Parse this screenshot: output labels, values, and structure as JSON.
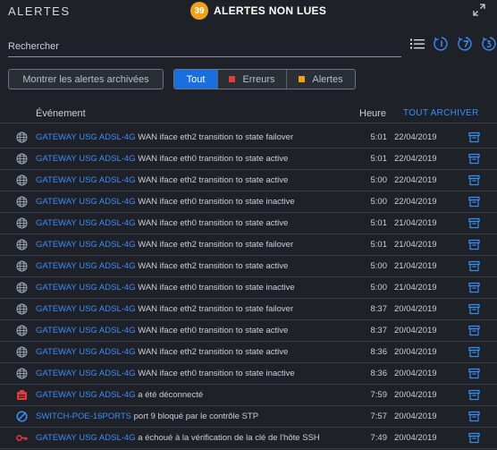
{
  "header": {
    "title": "ALERTES",
    "unread_count": "39",
    "unread_label": "ALERTES NON LUES"
  },
  "search": {
    "placeholder": "Rechercher"
  },
  "filters": {
    "show_archived": "Montrer les alertes archivées",
    "all": "Tout",
    "errors": "Erreurs",
    "alerts": "Alertes"
  },
  "columns": {
    "event": "Événement",
    "time": "Heure",
    "archive_all": "TOUT ARCHIVER"
  },
  "colors": {
    "accent": "#1a6fe0",
    "link": "#3b8cf5",
    "badge": "#f0a11c",
    "error": "#e23b3b",
    "warning": "#f0a11c"
  },
  "rows": [
    {
      "icon": "globe-icon",
      "device": "GATEWAY USG ADSL-4G",
      "message": "WAN iface eth2 transition to state failover",
      "time": "5:01",
      "date": "22/04/2019"
    },
    {
      "icon": "globe-icon",
      "device": "GATEWAY USG ADSL-4G",
      "message": "WAN iface eth0 transition to state active",
      "time": "5:01",
      "date": "22/04/2019"
    },
    {
      "icon": "globe-icon",
      "device": "GATEWAY USG ADSL-4G",
      "message": "WAN iface eth2 transition to state active",
      "time": "5:00",
      "date": "22/04/2019"
    },
    {
      "icon": "globe-icon",
      "device": "GATEWAY USG ADSL-4G",
      "message": "WAN iface eth0 transition to state inactive",
      "time": "5:00",
      "date": "22/04/2019"
    },
    {
      "icon": "globe-icon",
      "device": "GATEWAY USG ADSL-4G",
      "message": "WAN iface eth0 transition to state active",
      "time": "5:01",
      "date": "21/04/2019"
    },
    {
      "icon": "globe-icon",
      "device": "GATEWAY USG ADSL-4G",
      "message": "WAN iface eth2 transition to state failover",
      "time": "5:01",
      "date": "21/04/2019"
    },
    {
      "icon": "globe-icon",
      "device": "GATEWAY USG ADSL-4G",
      "message": "WAN iface eth2 transition to state active",
      "time": "5:00",
      "date": "21/04/2019"
    },
    {
      "icon": "globe-icon",
      "device": "GATEWAY USG ADSL-4G",
      "message": "WAN iface eth0 transition to state inactive",
      "time": "5:00",
      "date": "21/04/2019"
    },
    {
      "icon": "globe-icon",
      "device": "GATEWAY USG ADSL-4G",
      "message": "WAN iface eth2 transition to state failover",
      "time": "8:37",
      "date": "20/04/2019"
    },
    {
      "icon": "globe-icon",
      "device": "GATEWAY USG ADSL-4G",
      "message": "WAN iface eth0 transition to state active",
      "time": "8:37",
      "date": "20/04/2019"
    },
    {
      "icon": "globe-icon",
      "device": "GATEWAY USG ADSL-4G",
      "message": "WAN iface eth2 transition to state active",
      "time": "8:36",
      "date": "20/04/2019"
    },
    {
      "icon": "globe-icon",
      "device": "GATEWAY USG ADSL-4G",
      "message": "WAN iface eth0 transition to state inactive",
      "time": "8:36",
      "date": "20/04/2019"
    },
    {
      "icon": "device-disconnected-icon",
      "device": "GATEWAY USG ADSL-4G",
      "message": "a été déconnecté",
      "time": "7:59",
      "date": "20/04/2019"
    },
    {
      "icon": "blocked-icon",
      "device": "SWITCH-POE-16PORTS",
      "message": "port 9 bloqué par le contrôle STP",
      "time": "7:57",
      "date": "20/04/2019"
    },
    {
      "icon": "key-icon",
      "device": "GATEWAY USG ADSL-4G",
      "message": "a échoué à la vérification de la clé de l'hôte SSH",
      "time": "7:49",
      "date": "20/04/2019"
    }
  ]
}
